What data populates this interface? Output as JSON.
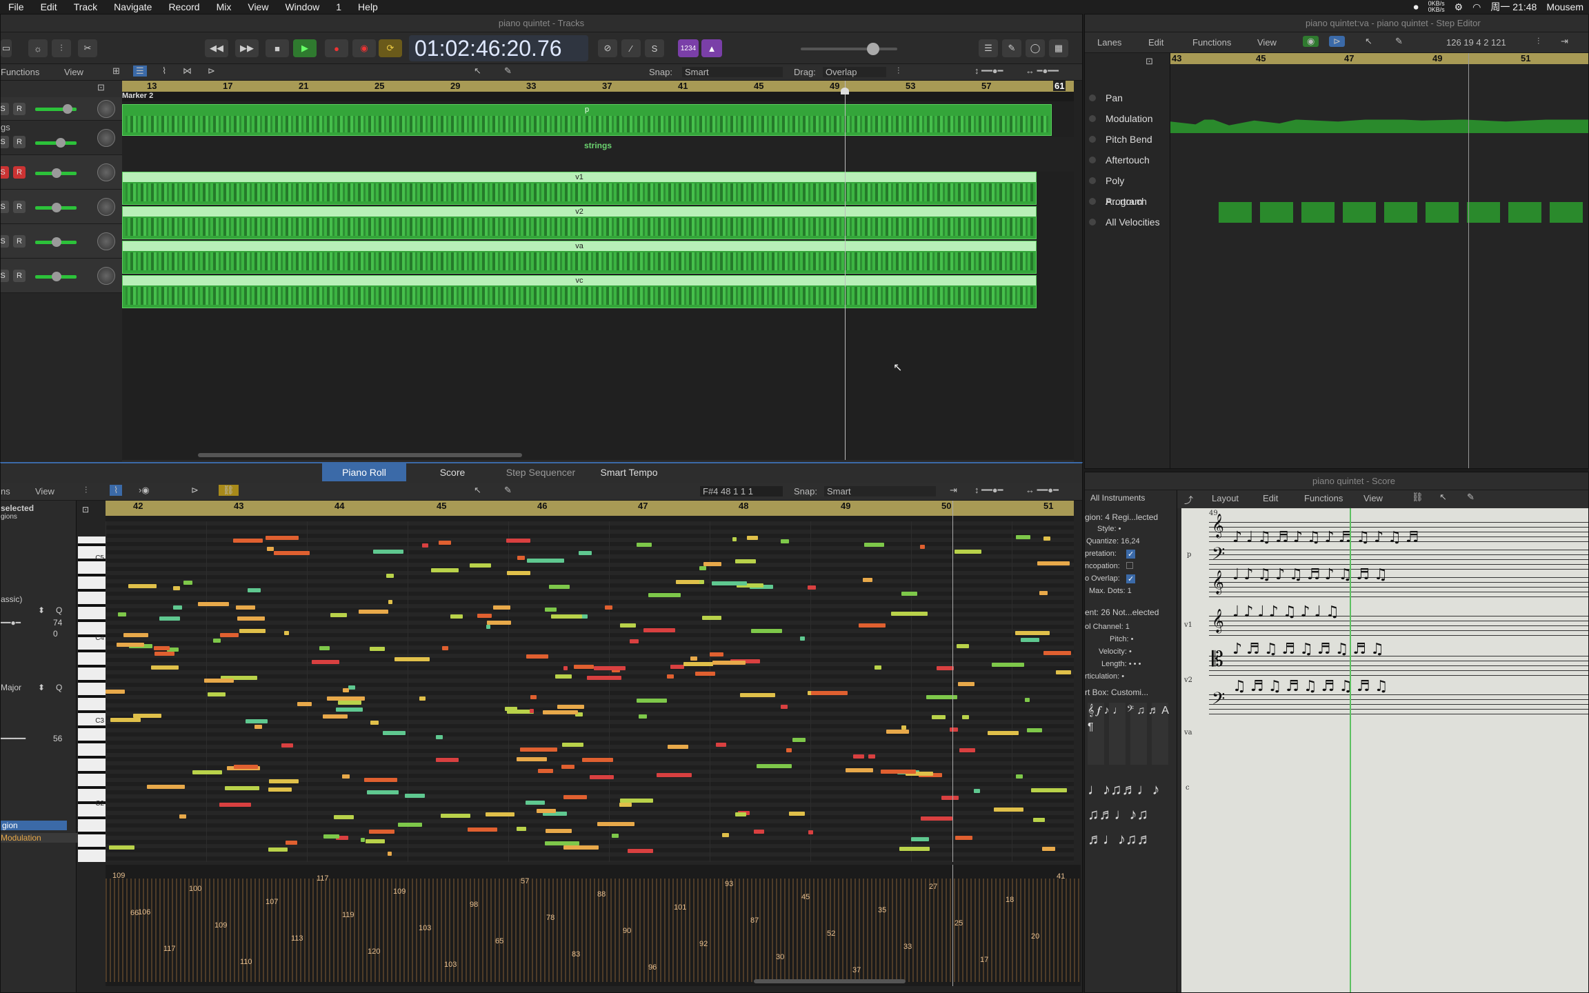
{
  "menubar": {
    "items": [
      "File",
      "Edit",
      "Track",
      "Navigate",
      "Record",
      "Mix",
      "View",
      "Window",
      "1",
      "Help"
    ],
    "time": "周一 21:48",
    "user": "Mousem",
    "net1": "0KB/s",
    "net2": "0KB/s"
  },
  "tracks_window": {
    "title": "piano quintet - Tracks",
    "lcd_time": "01:02:46:20.76",
    "lcd_bars": "1234",
    "snap_label": "Snap:",
    "snap_value": "Smart",
    "drag_label": "Drag:",
    "drag_value": "Overlap",
    "functions": "Functions",
    "view": "View",
    "marker": "Marker 2",
    "ruler": [
      "13",
      "17",
      "21",
      "25",
      "29",
      "33",
      "37",
      "41",
      "45",
      "49",
      "53",
      "57",
      "61"
    ],
    "folder_label": "strings",
    "track_header_label": "gs",
    "regions": [
      {
        "name": "p"
      },
      {
        "name": "v1"
      },
      {
        "name": "v2"
      },
      {
        "name": "va"
      },
      {
        "name": "vc"
      }
    ],
    "tracks": [
      "S",
      "S",
      "S",
      "S",
      "S",
      "S"
    ]
  },
  "step_editor": {
    "title": "piano quintet:va - piano quintet - Step Editor",
    "lanes": "Lanes",
    "edit": "Edit",
    "functions": "Functions",
    "view": "View",
    "position": "126  19 4 2 121",
    "ruler": [
      "43",
      "45",
      "47",
      "49",
      "51"
    ],
    "rows": [
      "Pan",
      "Modulation",
      "Pitch Bend",
      "Aftertouch",
      "Poly A...rtouch",
      "Program",
      "All Velocities"
    ]
  },
  "editor_tabs": [
    "Piano Roll",
    "Score",
    "Step Sequencer",
    "Smart Tempo"
  ],
  "piano_roll": {
    "view": "View",
    "ns": "ns",
    "pitch_pos": "F#4  48 1 1 1",
    "snap_label": "Snap:",
    "snap_value": "Smart",
    "ruler": [
      "42",
      "43",
      "44",
      "45",
      "46",
      "47",
      "48",
      "49",
      "50",
      "51"
    ],
    "selected": "selected",
    "regions": "gions",
    "classic": "assic)",
    "val1": "74",
    "val2": "0",
    "key": "Major",
    "q": "Q",
    "val3": "56",
    "region_btn": "gion",
    "modulation": "Modulation",
    "keys": [
      "C5",
      "C4",
      "C3",
      "C2"
    ],
    "velocities": [
      "109",
      "106",
      "117",
      "100",
      "109",
      "110",
      "107",
      "113",
      "117",
      "119",
      "120",
      "109",
      "103",
      "103",
      "98",
      "65",
      "57",
      "78",
      "83",
      "88",
      "90",
      "96",
      "101",
      "92",
      "93",
      "87",
      "30",
      "45",
      "52",
      "37",
      "35",
      "33",
      "27",
      "25",
      "17",
      "18",
      "20",
      "41",
      "66"
    ]
  },
  "score_window": {
    "title": "piano quintet - Score",
    "all_instruments": "All Instruments",
    "layout": "Layout",
    "edit": "Edit",
    "functions": "Functions",
    "view": "View",
    "region": "gion:  4 Regi...lected",
    "style": "Style: •",
    "quantize": "Quantize: 16,24",
    "interpretation": "pretation:",
    "syncopation": "ncopation:",
    "no_overlap": "o Overlap:",
    "max_dots": "Max. Dots: 1",
    "event": "ent:  26 Not...elected",
    "channel": "ol Channel: 1",
    "pitch": "Pitch: •",
    "velocity": "Velocity: •",
    "length": "Length: • • •",
    "articulation": "rticulation: •",
    "part_box": "rt Box:  Customi...",
    "instruments": [
      "p",
      "v1",
      "v2",
      "va",
      "c"
    ],
    "measure": "49"
  }
}
